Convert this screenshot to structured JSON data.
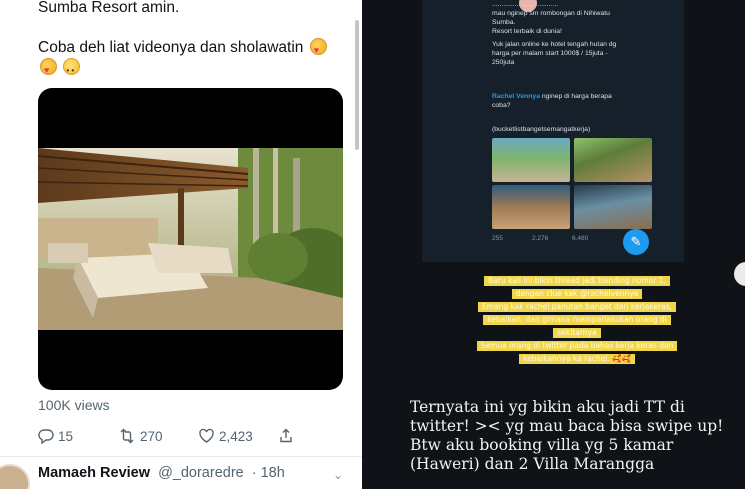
{
  "tweet": {
    "line1": "Sumba Resort amin.",
    "line2": "Coba deh liat videonya dan sholawatin",
    "emojis": [
      "smiling-face-with-hearts-icon",
      "smiling-face-with-hearts-icon",
      "pleading-face-icon"
    ],
    "views": "100K views",
    "replies": "15",
    "retweets": "270",
    "likes": "2,423"
  },
  "next_tweet": {
    "name": "Mamaeh Review",
    "handle": "@_doraredre",
    "time": "· 18h"
  },
  "story": {
    "embed": {
      "line_a1": "...................................",
      "line_a2": "mau nginep sm rombongan di Nihiwatu",
      "line_a3": "Sumba.",
      "line_a4": "Resort terbaik di dunia!",
      "line_b1": "Yuk jalan online ke hotel tengah hutan dg",
      "line_b2": "harga per malam start  1000$ / 15juta -",
      "line_b3": "250juta",
      "mention": "Rachel Vennya",
      "mention_rest": " nginep di harga berapa",
      "line_c2": "coba?",
      "hashtag": "(bucketlistbangetsemangatkerja)",
      "replies": "255",
      "retweets": "2.276",
      "likes": "6.480"
    },
    "highlights": [
      "Baru kali ini bikin thread jadi trending nomor 1,",
      "dengan clue kak @rachelvennya",
      "Emang kak rachel panutan banget dari kerjakeras,",
      "kebaikan, dan gimana memperlakukan orang di",
      "sekitarnya",
      "Semua orang di twitter pada bahas kerja keras dan",
      "kebaikannya ka rachel. 🥰🥰"
    ],
    "caption_lines": [
      "Ternyata ini yg bikin aku jadi TT di",
      "twitter! >< yg mau baca bisa swipe up!",
      "Btw aku booking villa yg 5 kamar",
      "(Haweri) dan 2 Villa Marangga"
    ]
  },
  "colors": {
    "twitter_blue": "#1d9bf0",
    "story_bg": "#0f1217",
    "highlight_yellow": "#f0d64a"
  }
}
